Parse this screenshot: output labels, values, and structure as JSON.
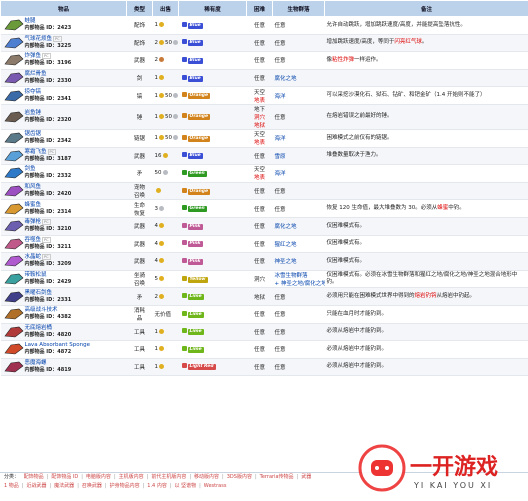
{
  "headers": {
    "item": "物品",
    "type": "类型",
    "source": "出售",
    "rarity": "稀有度",
    "hardmode": "困难",
    "biome": "生物群落",
    "notes": "备注"
  },
  "rows": [
    {
      "name": "蛙腿",
      "pc": false,
      "id_label": "内部物品 ID：",
      "id": "2423",
      "type": "配饰",
      "sell_num": "1",
      "coins": [
        "gold"
      ],
      "rarity": "Blue",
      "rar_color": "#3b4fd6",
      "hm": "任意",
      "hm_red": false,
      "biome": "任意",
      "biome_link": false,
      "notes": "允许自动跳跃，增加跳跃速度/高度，并能提高坠落抗性。",
      "notes_red": ""
    },
    {
      "name": "气球花烦鱼",
      "pc": true,
      "id_label": "内部物品 ID：",
      "id": "3225",
      "type": "配饰",
      "sell_num": "2",
      "coins": [
        "gold",
        "silver"
      ],
      "sell_extra": "50",
      "rarity": "Blue",
      "rar_color": "#3b4fd6",
      "hm": "任意",
      "hm_red": false,
      "biome": "任意",
      "biome_link": false,
      "notes": "增加跳跃速度/高度，等同于",
      "notes_red": "闪亮红气球",
      "notes_tail": "。"
    },
    {
      "name": "炸弹鱼",
      "pc": true,
      "id_label": "内部物品 ID：",
      "id": "3196",
      "type": "武器",
      "sell_num": "2",
      "coins": [
        "copper"
      ],
      "rarity": "Blue",
      "rar_color": "#3b4fd6",
      "hm": "任意",
      "hm_red": false,
      "biome": "任意",
      "biome_link": false,
      "notes": "像",
      "notes_red": "粘性炸弹",
      "notes_tail": "一样运作。"
    },
    {
      "name": "腐烂骨鱼",
      "pc": false,
      "id_label": "内部物品 ID：",
      "id": "2330",
      "type": "剑",
      "sell_num": "1",
      "coins": [
        "gold"
      ],
      "rarity": "Blue",
      "rar_color": "#3b4fd6",
      "hm": "任意",
      "hm_red": false,
      "biome": "腐化之地",
      "biome_link": true,
      "notes": "",
      "notes_red": ""
    },
    {
      "name": "掠夺镐",
      "pc": false,
      "id_label": "内部物品 ID：",
      "id": "2341",
      "type": "镐",
      "sell_num": "1",
      "coins": [
        "gold",
        "silver"
      ],
      "sell_extra": "50",
      "rarity": "Orange",
      "rar_color": "#d2831b",
      "hm": "天空",
      "hm_extra": "地表",
      "hm_red": true,
      "biome": "海洋",
      "biome_link": true,
      "notes": "可以采挖沙漠化石、狱石、钻矿、和钯金矿（1.4 开始则不能了）",
      "notes_red": ""
    },
    {
      "name": "岩鱼锤",
      "pc": false,
      "id_label": "内部物品 ID：",
      "id": "2320",
      "type": "锤",
      "sell_num": "1",
      "coins": [
        "gold",
        "silver"
      ],
      "sell_extra": "50",
      "rarity": "Orange",
      "rar_color": "#d2831b",
      "hm": "地下",
      "hm_extra": "洞穴",
      "hm_extra2": "地狱",
      "hm_red": true,
      "biome": "任意",
      "biome_link": false,
      "notes": "在熔岩错误之前最好的锤。",
      "notes_red": ""
    },
    {
      "name": "锯齿锯",
      "pc": false,
      "id_label": "内部物品 ID：",
      "id": "2342",
      "type": "链锯",
      "sell_num": "1",
      "coins": [
        "gold",
        "silver"
      ],
      "sell_extra": "50",
      "rarity": "Orange",
      "rar_color": "#d2831b",
      "hm": "天空",
      "hm_extra": "地表",
      "hm_red": true,
      "biome": "海洋",
      "biome_link": true,
      "notes": "困难模式之前仅有的链锯。",
      "notes_red": ""
    },
    {
      "name": "寒霜飞鱼",
      "pc": true,
      "id_label": "内部物品 ID：",
      "id": "3187",
      "type": "武器",
      "sell_num": "16",
      "coins": [
        "gold"
      ],
      "rarity": "Blue",
      "rar_color": "#3b4fd6",
      "hm": "任意",
      "hm_red": false,
      "biome": "雪原",
      "biome_link": true,
      "notes": "堆叠数量取决于渔力。",
      "notes_red": ""
    },
    {
      "name": "剑鱼",
      "pc": false,
      "id_label": "内部物品 ID：",
      "id": "2332",
      "type": "矛",
      "sell_num": "50",
      "coins": [
        "silver"
      ],
      "rarity": "Green",
      "rar_color": "#2f9a22",
      "hm": "天空",
      "hm_extra": "地表",
      "hm_red": true,
      "biome": "海洋",
      "biome_link": true,
      "notes": "",
      "notes_red": ""
    },
    {
      "name": "和风鱼",
      "pc": false,
      "id_label": "内部物品 ID：",
      "id": "2420",
      "type": "宠物",
      "type2": "召唤",
      "sell_num": "",
      "coins": [
        "gold"
      ],
      "rarity": "Orange",
      "rar_color": "#d2831b",
      "hm": "任意",
      "hm_red": false,
      "biome": "任意",
      "biome_link": false,
      "notes": "",
      "notes_red": ""
    },
    {
      "name": "蜂蜜鱼",
      "pc": false,
      "id_label": "内部物品 ID：",
      "id": "2314",
      "type": "生命",
      "type2": "恢复",
      "sell_num": "3",
      "coins": [
        "silver"
      ],
      "rarity": "Green",
      "rar_color": "#2f9a22",
      "hm": "任意",
      "hm_red": false,
      "biome": "任意",
      "biome_link": false,
      "notes": "恢复 120 生命值，最大堆叠数为 30。必须从",
      "notes_red": "蜂蜜",
      "notes_tail": "中钓。"
    },
    {
      "name": "毒弹枪",
      "pc": true,
      "id_label": "内部物品 ID：",
      "id": "3210",
      "type": "武器",
      "sell_num": "4",
      "coins": [
        "gold"
      ],
      "rarity": "Pink",
      "rar_color": "#c05a96",
      "hm": "任意",
      "hm_red": false,
      "biome": "腐化之地",
      "biome_link": true,
      "notes": "仅困难模式有。",
      "notes_red": ""
    },
    {
      "name": "吞噬鱼",
      "pc": true,
      "id_label": "内部物品 ID：",
      "id": "3211",
      "type": "武器",
      "sell_num": "4",
      "coins": [
        "gold"
      ],
      "rarity": "Pink",
      "rar_color": "#c05a96",
      "hm": "任意",
      "hm_red": false,
      "biome": "猩红之地",
      "biome_link": true,
      "notes": "仅困难模式有。",
      "notes_red": ""
    },
    {
      "name": "水晶蛇",
      "pc": true,
      "id_label": "内部物品 ID：",
      "id": "3209",
      "type": "武器",
      "sell_num": "4",
      "coins": [
        "gold"
      ],
      "rarity": "Pink",
      "rar_color": "#c05a96",
      "hm": "任意",
      "hm_red": false,
      "biome": "神圣之地",
      "biome_link": true,
      "notes": "仅困难模式有。",
      "notes_red": ""
    },
    {
      "name": "带鞍松鼠",
      "pc": false,
      "id_label": "内部物品 ID：",
      "id": "2429",
      "type": "坐骑",
      "type2": "召唤",
      "sell_num": "5",
      "coins": [
        "gold"
      ],
      "rarity": "Yellow",
      "rar_color": "#c0a60e",
      "hm": "洞穴",
      "hm_red": false,
      "biome": "冰雪生物群落",
      "biome2": "+ 神圣之地/腐化之地",
      "biome_link": true,
      "notes": "仅困难模式有。必须在冰雪生物群落和猩红之地/腐化之地/神圣之地混合地形中钓。",
      "notes_red": ""
    },
    {
      "name": "黑曜石剑鱼",
      "pc": false,
      "id_label": "内部物品 ID：",
      "id": "2331",
      "type": "矛",
      "sell_num": "2",
      "coins": [
        "gold"
      ],
      "rarity": "Lime",
      "rar_color": "#6fb61b",
      "hm": "地狱",
      "hm_red": true,
      "biome": "任意",
      "biome_link": false,
      "notes": "必须用只能在困难模式世界中得到的",
      "notes_red": "熔岩钓钩",
      "notes_tail": "从熔岩中钓起。"
    },
    {
      "name": "高级战斗技术",
      "pc": false,
      "id_label": "内部物品 ID：",
      "id": "4382",
      "type": "消耗",
      "type2": "品",
      "sell_num": "",
      "sell_text": "无价值",
      "rarity": "Lime",
      "rar_color": "#6fb61b",
      "hm": "任意",
      "hm_red": false,
      "biome": "任意",
      "biome_link": false,
      "notes": "只能在血月时才能钓到。",
      "notes_red": ""
    },
    {
      "name": "无底熔岩桶",
      "pc": false,
      "id_label": "内部物品 ID：",
      "id": "4820",
      "type": "工具",
      "sell_num": "1",
      "coins": [
        "gold"
      ],
      "rarity": "Lime",
      "rar_color": "#6fb61b",
      "hm": "任意",
      "hm_red": false,
      "biome": "任意",
      "biome_link": false,
      "notes": "必须从熔岩中才能钓到。",
      "notes_red": ""
    },
    {
      "name": "Lava Absorbant Sponge",
      "pc": false,
      "id_label": "内部物品 ID：",
      "id": "4872",
      "type": "工具",
      "sell_num": "1",
      "coins": [
        "gold"
      ],
      "rarity": "Lime",
      "rar_color": "#6fb61b",
      "hm": "任意",
      "hm_red": false,
      "biome": "任意",
      "biome_link": false,
      "notes": "必须从熔岩中才能钓到。",
      "notes_red": ""
    },
    {
      "name": "恶魔海螺",
      "pc": false,
      "id_label": "内部物品 ID：",
      "id": "4819",
      "type": "工具",
      "sell_num": "1",
      "coins": [
        "gold"
      ],
      "rarity": "Light Red",
      "rar_color": "#d64a4a",
      "hm": "任意",
      "hm_red": false,
      "biome": "任意",
      "biome_link": false,
      "notes": "必须从熔岩中才能钓到。",
      "notes_red": ""
    }
  ],
  "footer": {
    "label": "分类：",
    "row1": [
      "配饰物品",
      "配饰物品 ID",
      "电脑版内容",
      "主机版内容",
      "前代主机版内容",
      "移动版内容",
      "3DS版内容",
      "Terraria传物品",
      "武器"
    ],
    "row2": [
      "1 物品",
      "近战武器",
      "魔法武器",
      "召唤武器",
      "护身物品内容",
      "1.4 内容",
      "以 坚谱物",
      "Westrass"
    ]
  },
  "watermark": {
    "title": "一开游戏",
    "sub": "YI KAI YOU XI"
  }
}
